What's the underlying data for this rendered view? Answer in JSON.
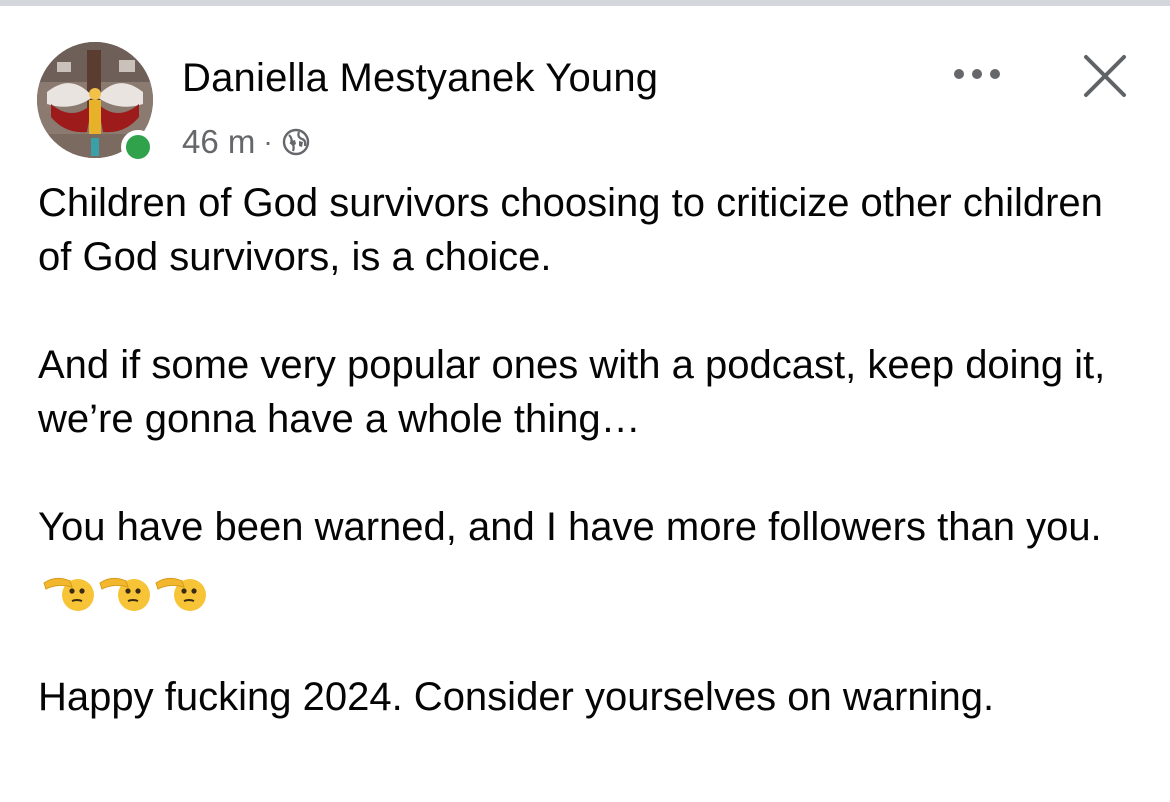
{
  "post": {
    "author_name": "Daniella Mestyanek Young",
    "time_ago": "46 m",
    "separator": "·",
    "audience_icon": "globe-icon",
    "online": true,
    "more_icon": "more-options-icon",
    "close_icon": "close-icon",
    "paragraphs": [
      "Children of God survivors choosing to criticize other children of God survivors,  is a choice.",
      "And if some very popular ones with a podcast, keep doing it, we’re gonna have a whole thing…",
      "You have been warned, and I have more followers than you.",
      "Happy fucking 2024. Consider yourselves on warning."
    ],
    "emojis": [
      "saluting-face-emoji",
      "saluting-face-emoji",
      "saluting-face-emoji"
    ]
  },
  "colors": {
    "online": "#31a24c",
    "secondary_text": "#65676b",
    "primary_text": "#050505"
  }
}
